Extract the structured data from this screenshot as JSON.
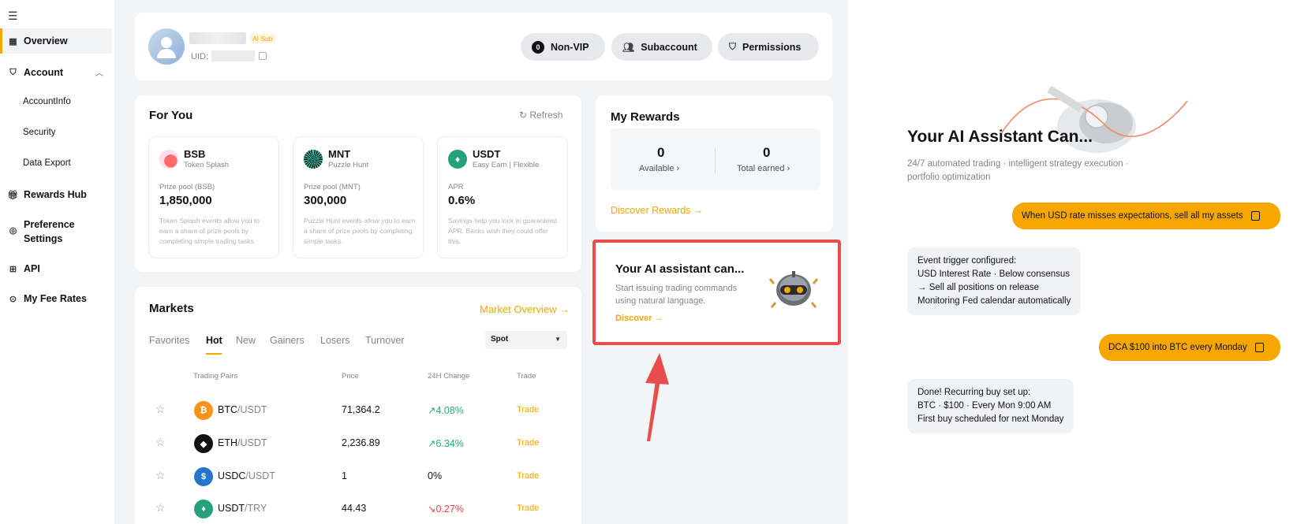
{
  "sidebar": {
    "items": [
      {
        "label": "Overview",
        "icon": "grid-icon"
      },
      {
        "label": "Account",
        "icon": "shield-icon"
      },
      {
        "label": "Rewards Hub",
        "icon": "gift-icon"
      },
      {
        "label": "Preference Settings",
        "icon": "sliders-icon"
      },
      {
        "label": "API",
        "icon": "api-icon"
      },
      {
        "label": "My Fee Rates",
        "icon": "fee-icon"
      }
    ],
    "account_sub": [
      "AccountInfo",
      "Security",
      "Data Export"
    ]
  },
  "profile": {
    "badge": "AI Sub",
    "uid_label": "UID:",
    "vip_level": "0",
    "buttons": [
      "Non-VIP",
      "Subaccount",
      "Permissions"
    ]
  },
  "for_you": {
    "title": "For You",
    "refresh": "Refresh",
    "cards": [
      {
        "symbol": "BSB",
        "sub": "Token Splash",
        "label": "Prize pool (BSB)",
        "value": "1,850,000",
        "desc": "Token Splash events allow you to earn a share of prize pools by completing simple trading tasks."
      },
      {
        "symbol": "MNT",
        "sub": "Puzzle Hunt",
        "label": "Prize pool (MNT)",
        "value": "300,000",
        "desc": "Puzzle Hunt events allow you to earn a share of prize pools by completing simple tasks."
      },
      {
        "symbol": "USDT",
        "sub": "Easy Earn | Flexible",
        "label": "APR",
        "value": "0.6%",
        "desc": "Savings help you lock in guaranteed APR. Banks wish they could offer this."
      }
    ]
  },
  "markets": {
    "title": "Markets",
    "overview_link": "Market Overview →",
    "tabs": [
      "Favorites",
      "Hot",
      "New",
      "Gainers",
      "Losers",
      "Turnover"
    ],
    "select": "Spot",
    "headers": [
      "Trading Pairs",
      "Price",
      "24H Change",
      "Trade"
    ],
    "rows": [
      {
        "base": "BTC",
        "quote": "/USDT",
        "price": "71,364.2",
        "change": "↗4.08%",
        "trade": "Trade",
        "color": "#f7931a",
        "chg_color": "#20b26c"
      },
      {
        "base": "ETH",
        "quote": "/USDT",
        "price": "2,236.89",
        "change": "↗6.34%",
        "trade": "Trade",
        "color": "#121214",
        "chg_color": "#20b26c"
      },
      {
        "base": "USDC",
        "quote": "/USDT",
        "price": "1",
        "change": "0%",
        "trade": "Trade",
        "color": "#2775ca",
        "chg_color": "#121214"
      },
      {
        "base": "USDT",
        "quote": "/TRY",
        "price": "44.43",
        "change": "↘0.27%",
        "trade": "Trade",
        "color": "#26a17b",
        "chg_color": "#ef454a"
      }
    ]
  },
  "rewards": {
    "title": "My Rewards",
    "available_value": "0",
    "available_label": "Available",
    "earned_value": "0",
    "earned_label": "Total earned",
    "discover": "Discover Rewards →"
  },
  "ai_card": {
    "title": "Your AI assistant can...",
    "desc": "Start issuing trading commands using natural language.",
    "discover": "Discover →"
  },
  "right_panel": {
    "title": "Your AI Assistant Can...",
    "subtitle": "24/7 automated trading · intelligent strategy execution · portfolio optimization",
    "user_msg_1": "When USD rate misses expectations, sell all my assets",
    "bot_msg_1": [
      "Event trigger configured:",
      "USD Interest Rate · Below consensus",
      "→ Sell all positions on release",
      "Monitoring Fed calendar automatically"
    ],
    "user_msg_2": "DCA $100 into BTC every Monday",
    "bot_msg_2": [
      "Done! Recurring buy set up:",
      "BTC · $100 · Every Mon 9:00 AM",
      "First buy scheduled for next Monday"
    ]
  }
}
